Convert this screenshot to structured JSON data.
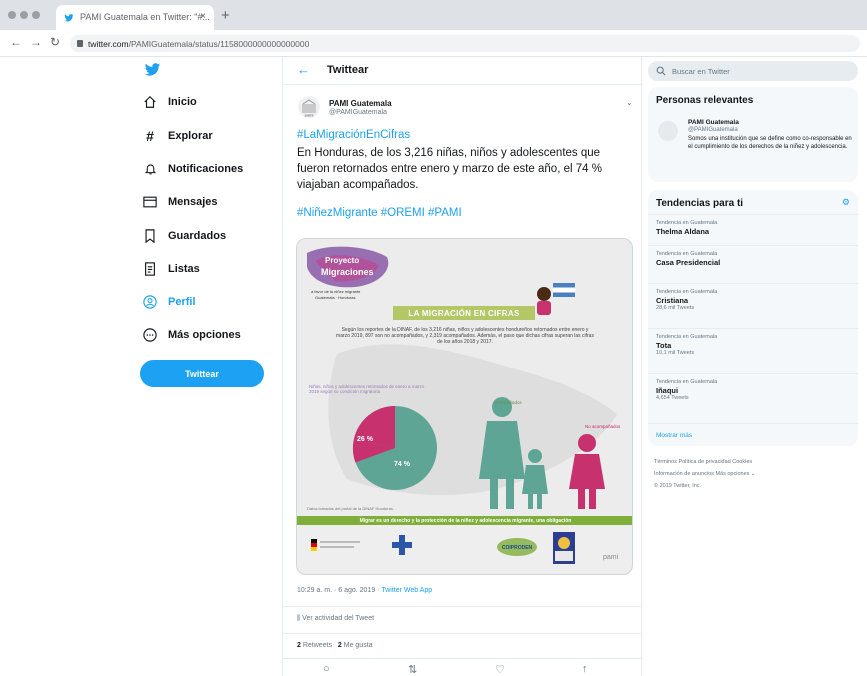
{
  "browser": {
    "tab_title": "PAMI Guatemala en Twitter: \"#...",
    "tab_close": "×",
    "new_tab": "+",
    "url_host": "twitter.com",
    "url_path": "/PAMIGuatemala/status/1158000000000000000"
  },
  "nav": {
    "items": [
      {
        "label": "Inicio",
        "icon": "home-icon"
      },
      {
        "label": "Explorar",
        "icon": "hash-icon"
      },
      {
        "label": "Notificaciones",
        "icon": "bell-icon"
      },
      {
        "label": "Mensajes",
        "icon": "envelope-icon"
      },
      {
        "label": "Guardados",
        "icon": "bookmark-icon"
      },
      {
        "label": "Listas",
        "icon": "list-icon"
      },
      {
        "label": "Perfil",
        "icon": "profile-icon"
      },
      {
        "label": "Más opciones",
        "icon": "more-icon"
      }
    ],
    "tweet_button": "Twittear",
    "active_color": "#1da1f2"
  },
  "header": {
    "back": "←",
    "title": "Twittear"
  },
  "tweet": {
    "author_name": "PAMI Guatemala",
    "author_handle": "@PAMIGuatemala",
    "hashtag_top": "#LaMigraciónEnCifras",
    "body": "En Honduras, de los 3,216 niñas, niños y adolescentes que fueron retornados entre enero y marzo de este año, el 74 % viajaban acompañados.",
    "hashtags_bottom": "#NiñezMigrante #OREMI #PAMI",
    "time": "10:29 a. m. · 6 ago. 2019 ·",
    "app": "Twitter Web App",
    "activity": "Ver actividad del Tweet",
    "retweets": "2",
    "retweets_label": "Retweets",
    "likes": "2",
    "likes_label": "Me gusta"
  },
  "infographic": {
    "title": "LA MIGRACIÓN EN CIFRAS",
    "intro": "Según los reportes de la DINAF, de los 3,216 niñas, niños y adolescentes hondureños retornados entre enero y marzo 2019, 897 son no acompañados, y 2,319 acompañados. Además, el paso que dichas cifras superan las cifras de los años 2018 y 2017.",
    "note_top": "Niñas, niños y adolescentes retornados de enero a marzo 2019 según su condición migratoria",
    "note_mid": "Acompañados",
    "note_right": "No acompañados",
    "pct_unaccompanied": "26 %",
    "pct_accompanied": "74 %",
    "source": "Datos tomados del portal de la DINAF Honduras.",
    "banner": "Migrar es un derecho y la protección de la niñez y adolescencia migrante, una obligación",
    "logo_tag": "Proyecto Migraciones",
    "chart_values": {
      "accompanied": 74,
      "unaccompanied": 26
    },
    "colors": {
      "accompanied": "#5fa596",
      "unaccompanied": "#c7316d",
      "banner": "#7fae3a"
    }
  },
  "actions": [
    "reply-icon",
    "retweet-icon",
    "like-icon",
    "share-icon"
  ],
  "right": {
    "search_placeholder": "Buscar en Twitter",
    "relevant_title": "Personas relevantes",
    "relevant_name": "PAMI Guatemala",
    "relevant_handle": "@PAMIGuatemala",
    "relevant_bio": "Somos una institución que se define como co-responsable en el cumplimiento de los derechos de la niñez y adolescencia.",
    "trends_title": "Tendencias para ti",
    "trends": [
      {
        "context": "Tendencia en Guatemala",
        "name": "Thelma Aldana",
        "count": ""
      },
      {
        "context": "Tendencia en Guatemala",
        "name": "Casa Presidencial",
        "count": ""
      },
      {
        "context": "Tendencia en Guatemala",
        "name": "Cristiana",
        "count": "28,6 mil Tweets"
      },
      {
        "context": "Tendencia en Guatemala",
        "name": "Tota",
        "count": "10,1 mil Tweets"
      },
      {
        "context": "Tendencia en Guatemala",
        "name": "Iñaqui",
        "count": "4,654 Tweets"
      }
    ],
    "show_more": "Mostrar más",
    "footer": [
      "Términos    Política de privacidad    Cookies",
      "Información de anuncios    Más opciones ⌄",
      "© 2019 Twitter, Inc."
    ]
  }
}
